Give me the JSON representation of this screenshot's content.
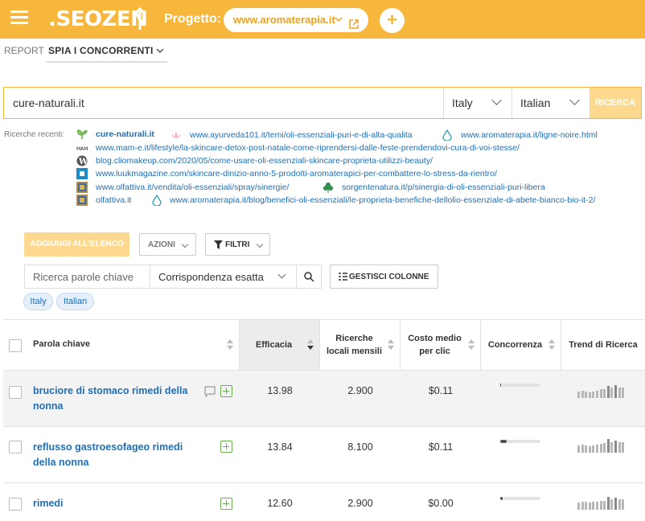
{
  "header": {
    "logo_text": ".SEOZEN",
    "project_label": "Progetto:",
    "project_domain": "www.aromaterapia.it",
    "add_label": "+",
    "brand_color": "#f6b73c"
  },
  "breadcrumb": {
    "report": "REPORT",
    "active": "SPIA I CONCORRENTI"
  },
  "search": {
    "domain_value": "cure-naturali.it",
    "country": "Italy",
    "language": "Italian",
    "submit_label": "RICERCA"
  },
  "recent": {
    "label": "Ricerche recenti:",
    "items": [
      {
        "text": "cure-naturali.it",
        "icon": "leaf-icon"
      },
      {
        "text": "www.ayurveda101.it/temi/oli-essenziali-puri-e-di-alta-qualita",
        "icon": "lotus-icon"
      },
      {
        "text": "www.aromaterapia.it/ligne-noire.html",
        "icon": "drop-icon"
      },
      {
        "text": "www.mam-e.it/lifestyle/la-skincare-detox-post-natale-come-riprendersi-dalle-feste-prendendovi-cura-di-voi-stesse/",
        "icon": "mame-logo-icon"
      },
      {
        "text": "blog.cliomakeup.com/2020/05/come-usare-oli-essenziali-skincare-proprieta-utilizzi-beauty/",
        "icon": "wordpress-icon"
      },
      {
        "text": "www.luukmagazine.com/skincare-dinizio-anno-5-prodotti-aromaterapici-per-combattere-lo-stress-da-rientro/",
        "icon": "square-icon"
      },
      {
        "text": "www.olfattiva.it/vendita/oli-essenziali/spray/sinergie/",
        "icon": "olfattiva-icon"
      },
      {
        "text": "sorgentenatura.it/p/sinergia-di-oli-essenziali-puri-libera",
        "icon": "clover-icon"
      },
      {
        "text": "olfattiva.it",
        "icon": "olfattiva-icon"
      },
      {
        "text": "www.aromaterapia.it/blog/benefici-oli-essenziali/le-proprieta-benefiche-dellolio-essenziale-di-abete-bianco-bio-it-2/",
        "icon": "drop-icon"
      }
    ]
  },
  "toolbar": {
    "add_to_list": "AGGIUNGI ALL'ELENCO",
    "actions": "AZIONI",
    "filters": "FILTRI",
    "keyword_placeholder": "Ricerca parole chiave",
    "match_type": "Corrispondenza esatta",
    "manage_columns": "GESTISCI COLONNE"
  },
  "tags": [
    "Italy",
    "Italian"
  ],
  "table": {
    "columns": [
      "Parola chiave",
      "Efficacia",
      "Ricerche locali mensili",
      "Costo medio per clic",
      "Concorrenza",
      "Trend di Ricerca"
    ],
    "rows": [
      {
        "keyword": "bruciore di stomaco rimedi della nonna",
        "efficacia": "13.98",
        "ricerche": "2.900",
        "cpc": "$0.11",
        "competition": 0.02,
        "trend": [
          0.45,
          0.5,
          0.45,
          0.4,
          0.45,
          0.5,
          0.6,
          0.6,
          0.85,
          0.7,
          0.9,
          0.75,
          0.7
        ]
      },
      {
        "keyword": "reflusso gastroesofageo rimedi della nonna",
        "efficacia": "13.84",
        "ricerche": "8.100",
        "cpc": "$0.11",
        "competition": 0.16,
        "trend": [
          0.5,
          0.55,
          0.5,
          0.45,
          0.5,
          0.55,
          0.6,
          0.65,
          0.95,
          0.75,
          0.85,
          0.7,
          0.7
        ]
      },
      {
        "keyword": "rimedi",
        "efficacia": "12.60",
        "ricerche": "2.900",
        "cpc": "$0.00",
        "competition": 0.05,
        "trend": [
          0.5,
          0.55,
          0.55,
          0.5,
          0.55,
          0.55,
          0.6,
          0.6,
          0.9,
          0.7,
          0.85,
          0.7,
          0.7
        ]
      }
    ]
  }
}
